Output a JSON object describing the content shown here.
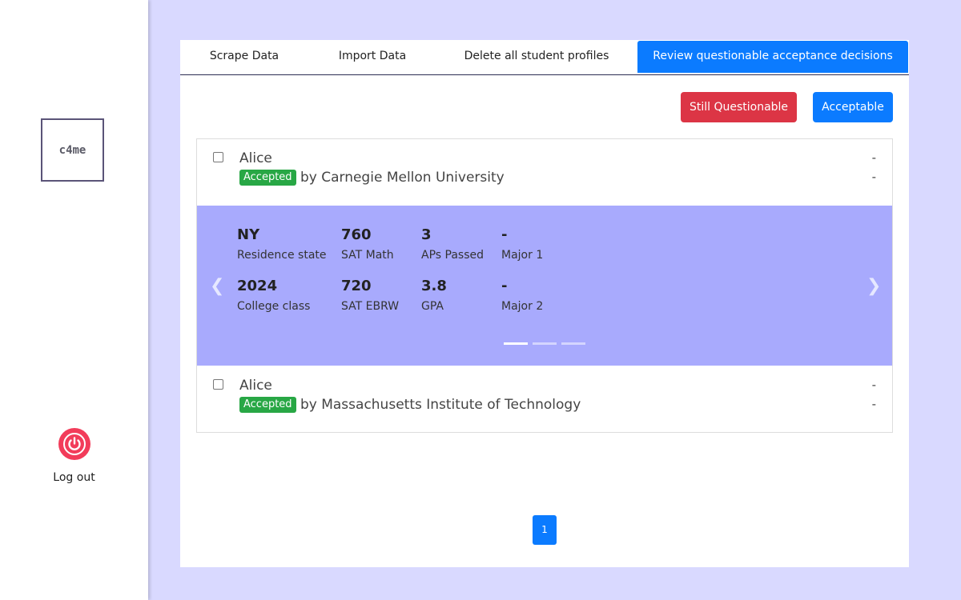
{
  "sidebar": {
    "logo": "c4me",
    "logout_label": "Log out",
    "logout_icon": "power-icon"
  },
  "tabs": [
    {
      "label": "Scrape Data"
    },
    {
      "label": "Import Data"
    },
    {
      "label": "Delete all student profiles"
    },
    {
      "label": "Review questionable acceptance decisions",
      "active": true
    }
  ],
  "actions": {
    "still_questionable": "Still Questionable",
    "acceptable": "Acceptable"
  },
  "decisions": [
    {
      "name": "Alice",
      "status": "Accepted",
      "college": "by Carnegie Mellon University",
      "right1": "-",
      "right2": "-",
      "expanded": true
    },
    {
      "name": "Alice",
      "status": "Accepted",
      "college": "by Massachusetts Institute of Technology",
      "right1": "-",
      "right2": "-",
      "expanded": false
    }
  ],
  "profile_stats": {
    "residence_state": {
      "value": "NY",
      "label": "Residence state"
    },
    "sat_math": {
      "value": "760",
      "label": "SAT Math"
    },
    "aps_passed": {
      "value": "3",
      "label": "APs Passed"
    },
    "major1": {
      "value": "-",
      "label": "Major 1"
    },
    "college_class": {
      "value": "2024",
      "label": "College class"
    },
    "sat_ebrw": {
      "value": "720",
      "label": "SAT EBRW"
    },
    "gpa": {
      "value": "3.8",
      "label": "GPA"
    },
    "major2": {
      "value": "-",
      "label": "Major 2"
    }
  },
  "carousel": {
    "prev_icon": "chevron-left-icon",
    "next_icon": "chevron-right-icon",
    "slide_count": 3,
    "active_slide": 1
  },
  "pagination": {
    "current_page": "1"
  },
  "colors": {
    "background": "#d9d9ff",
    "primary": "#0b7bff",
    "danger": "#dc3545",
    "success": "#28a745",
    "carousel": "#a8aafd",
    "logout": "#f23c5a"
  }
}
